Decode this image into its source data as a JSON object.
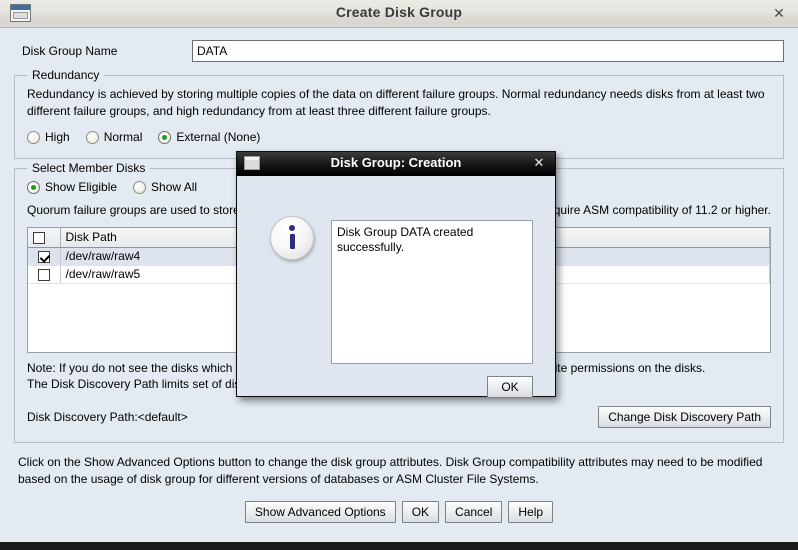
{
  "window": {
    "title": "Create Disk Group",
    "icon": "window-icon",
    "close_label": "✕"
  },
  "form": {
    "disk_group_name_label": "Disk Group Name",
    "disk_group_name_value": "DATA",
    "disk_group_name_placeholder": ""
  },
  "redundancy": {
    "legend": "Redundancy",
    "description": "Redundancy is achieved by storing multiple copies of the data on different failure groups. Normal redundancy needs disks from at least two different failure groups, and high redundancy from at least three different failure groups.",
    "options": [
      {
        "label": "High",
        "selected": false
      },
      {
        "label": "Normal",
        "selected": false
      },
      {
        "label": "External (None)",
        "selected": true
      }
    ]
  },
  "member_disks": {
    "legend": "Select Member Disks",
    "filters": [
      {
        "label": "Show Eligible",
        "selected": true
      },
      {
        "label": "Show All",
        "selected": false
      }
    ],
    "quorum_note": "Quorum failure groups are used to store voting files and they cannot contain any user data. They require ASM compatibility of 11.2 or higher.",
    "table": {
      "columns": [
        "",
        "Disk Path",
        ""
      ],
      "header_checkbox_checked": false,
      "rows": [
        {
          "checked": true,
          "disk_path": "/dev/raw/raw4",
          "selected": true
        },
        {
          "checked": false,
          "disk_path": "/dev/raw/raw5",
          "selected": false
        }
      ]
    },
    "note_line1": "Note: If you do not see the disks which you believe are eligible, check whether the user has read/write permissions on the disks.",
    "note_line2": "The Disk Discovery Path limits set of disks considered for discovery.",
    "discovery_path_label": "Disk Discovery Path:<default>",
    "change_path_button": "Change Disk Discovery Path"
  },
  "footer": {
    "text": "Click on the Show Advanced Options button to change the disk group attributes. Disk Group compatibility attributes may need to be modified based on the usage of disk group for different versions of databases or ASM Cluster File Systems.",
    "buttons": [
      "Show Advanced Options",
      "OK",
      "Cancel",
      "Help"
    ]
  },
  "modal": {
    "title": "Disk Group: Creation",
    "close_label": "✕",
    "icon": "info-icon",
    "message": "Disk Group DATA created successfully.",
    "ok_button": "OK"
  },
  "colors": {
    "background": "#e4eaf2",
    "accent": "#1f9c1f",
    "info_blue": "#2d2d7a",
    "selection": "#dde3ee"
  }
}
